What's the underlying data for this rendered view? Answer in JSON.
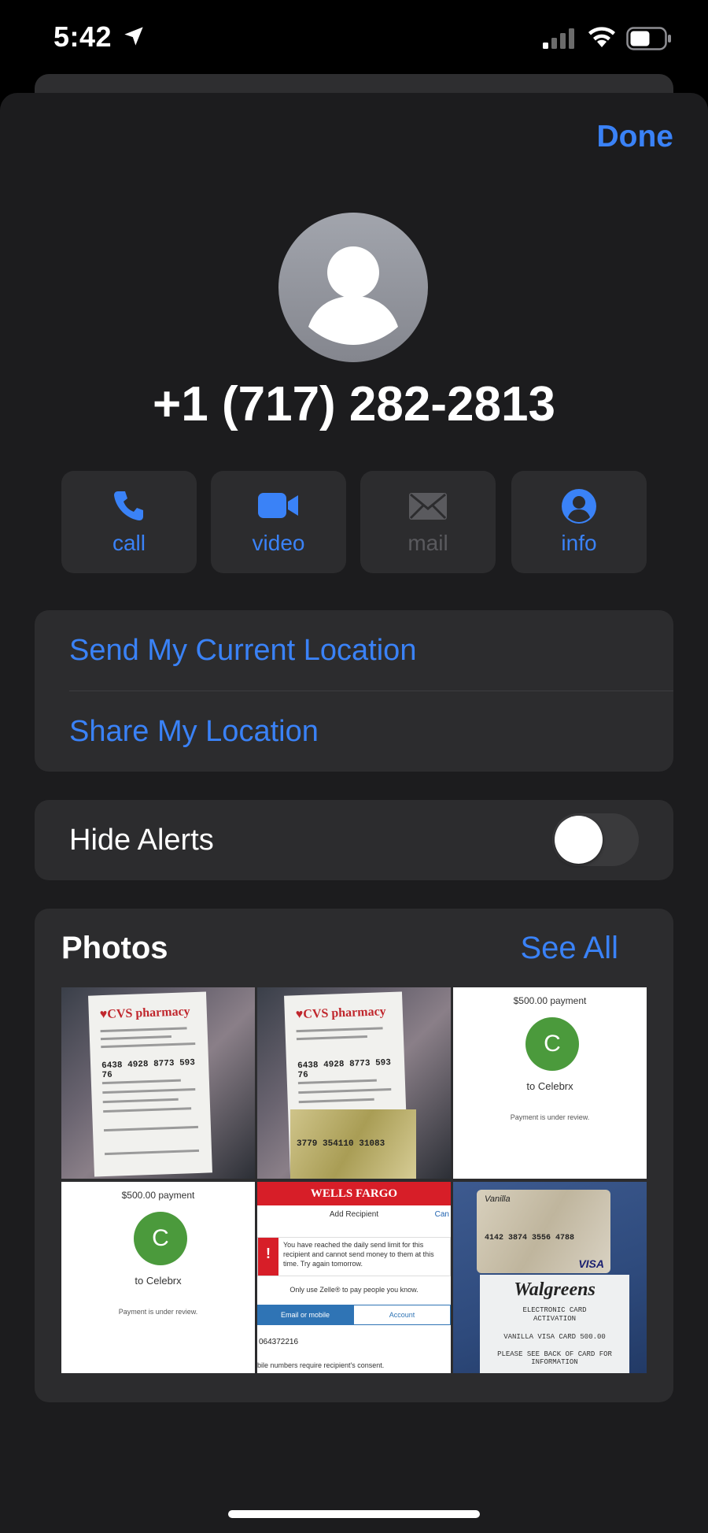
{
  "status_bar": {
    "time": "5:42"
  },
  "header": {
    "done_label": "Done"
  },
  "contact": {
    "phone": "+1 (717) 282-2813"
  },
  "actions": [
    {
      "label": "call",
      "icon": "phone-icon",
      "enabled": true
    },
    {
      "label": "video",
      "icon": "video-camera-icon",
      "enabled": true
    },
    {
      "label": "mail",
      "icon": "envelope-icon",
      "enabled": false
    },
    {
      "label": "info",
      "icon": "person-circle-icon",
      "enabled": true
    }
  ],
  "location": {
    "send_current": "Send My Current Location",
    "share": "Share My Location"
  },
  "alerts": {
    "label": "Hide Alerts",
    "enabled": false
  },
  "photos": {
    "title": "Photos",
    "see_all": "See All",
    "tiles": {
      "receipt1": {
        "brand": "♥CVS pharmacy",
        "number": "6438 4928 8773 593 76"
      },
      "receipt2": {
        "brand": "♥CVS pharmacy",
        "number": "6438 4928 8773 593 76",
        "card_number": "3779  354110  31083"
      },
      "payment1": {
        "amount": "$500.00 payment",
        "initial": "C",
        "to": "to Celebrx",
        "status": "Payment is under review."
      },
      "payment2": {
        "amount": "$500.00 payment",
        "initial": "C",
        "to": "to Celebrx",
        "status": "Payment is under review."
      },
      "wells_fargo": {
        "header": "WELLS FARGO",
        "subtitle": "Add Recipient",
        "cancel": "Can",
        "alert": "You have reached the daily send limit for this recipient and cannot send money to them at this time. Try again tomorrow.",
        "only_use": "Only use Zelle® to pay people you know.",
        "tab_email": "Email or mobile",
        "tab_account": "Account",
        "number": "064372216",
        "footer": "bile numbers require recipient's consent."
      },
      "walgreens": {
        "card_brand": "Vanilla",
        "card_number": "4142 3874 3556 4788",
        "network": "VISA",
        "store": "Walgreens",
        "line1": "ELECTRONIC CARD",
        "line2": "ACTIVATION",
        "line3": "VANILLA VISA CARD    500.00",
        "line4": "PLEASE SEE BACK OF CARD FOR INFORMATION"
      }
    }
  },
  "colors": {
    "accent": "#3a82f7",
    "sheet": "#1c1c1e",
    "cell": "#2c2c2e"
  }
}
